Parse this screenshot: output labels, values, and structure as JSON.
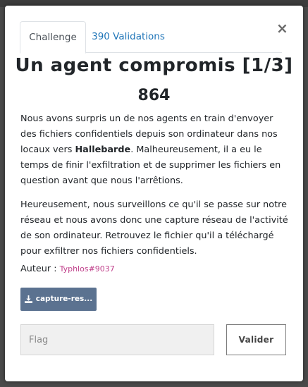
{
  "tabs": [
    {
      "label": "Challenge"
    },
    {
      "label": "390 Validations"
    }
  ],
  "close_label": "×",
  "challenge": {
    "title": "Un agent compromis [1/3]",
    "points": "864",
    "description": {
      "p1_before": "Nous avons surpris un de nos agents en train d'envoyer des fichiers confidentiels depuis son ordinateur dans nos locaux vers ",
      "p1_bold": "Hallebarde",
      "p1_after": ". Malheureusement, il a eu le temps de finir l'exfiltration et de supprimer les fichiers en question avant que nous l'arrêtions.",
      "p2": "Heureusement, nous surveillons ce qu'il se passe sur notre réseau et nous avons donc une capture réseau de l'activité de son ordinateur. Retrouvez le fichier qu'il a téléchargé pour exfiltrer nos fichiers confidentiels."
    },
    "author_label": "Auteur : ",
    "author_name": "Typhlos#9037",
    "file_label": "capture-res...",
    "file_icon": "download-icon"
  },
  "form": {
    "flag_placeholder": "Flag",
    "submit_label": "Valider"
  }
}
